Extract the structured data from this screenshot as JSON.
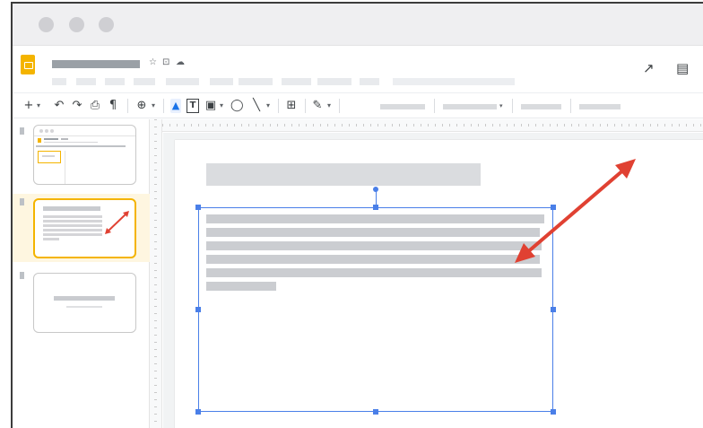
{
  "window": {
    "controls": [
      "close-dot",
      "minimize-dot",
      "maximize-dot"
    ]
  },
  "header": {
    "logo_icon": "slides-logo-icon",
    "title_icons": {
      "star": "☆",
      "move": "⊡",
      "cloud": "☁"
    },
    "right_icons": {
      "trend": "↗",
      "comments": "▤"
    }
  },
  "toolbar": {
    "new": "+",
    "new_caret": "▾",
    "undo": "↶",
    "redo": "↷",
    "print": "⎙",
    "paint_format": "¶",
    "zoom": "⊕",
    "zoom_caret": "▾",
    "select": "▲",
    "textbox": "T",
    "image": "▣",
    "image_caret": "▾",
    "shape": "◯",
    "line": "╲",
    "line_caret": "▾",
    "comment_add": "⊞",
    "pen": "✎",
    "pen_caret": "▾",
    "dropdown_caret": "▾"
  },
  "slides": [
    {
      "index": 1,
      "state": "thumbnail"
    },
    {
      "index": 2,
      "state": "selected"
    },
    {
      "index": 3,
      "state": "thumbnail"
    }
  ],
  "annotation": {
    "arrow_color": "#e04132",
    "meaning": "resize-direction-arrow"
  },
  "colors": {
    "accent": "#f4b400",
    "selection": "#4a7fe8",
    "arrow": "#e04132"
  }
}
